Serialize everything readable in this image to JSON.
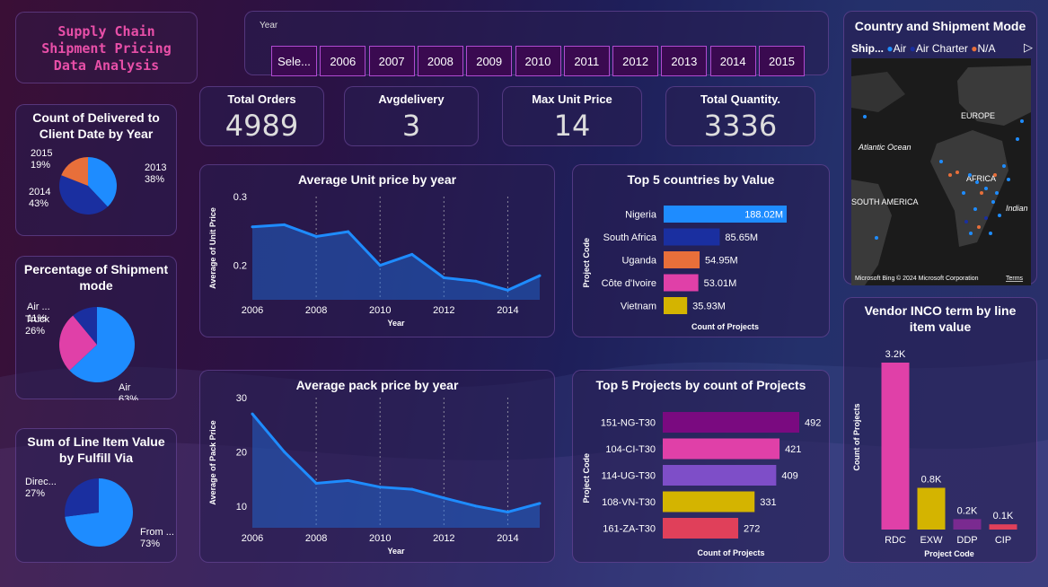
{
  "report_title": [
    "Supply Chain",
    "Shipment Pricing",
    "Data Analysis"
  ],
  "year_filter": {
    "label": "Year",
    "options": [
      "Sele...",
      "2006",
      "2007",
      "2008",
      "2009",
      "2010",
      "2011",
      "2012",
      "2013",
      "2014",
      "2015"
    ]
  },
  "kpis": [
    {
      "label": "Total Orders",
      "value": "4989"
    },
    {
      "label": "Avgdelivery",
      "value": "3"
    },
    {
      "label": "Max Unit Price",
      "value": "14"
    },
    {
      "label": "Total Quantity.",
      "value": "3336"
    }
  ],
  "map": {
    "title": "Country and Shipment Mode",
    "legend_title": "Ship...",
    "legend": [
      {
        "name": "Air",
        "color": "#1e8cff"
      },
      {
        "name": "Air Charter",
        "color": "#1a2fa0"
      },
      {
        "name": "N/A",
        "color": "#e86f3a"
      }
    ],
    "labels": [
      "Atlantic Ocean",
      "EUROPE",
      "AFRICA",
      "SOUTH AMERICA",
      "Indian"
    ],
    "credit": "© 2024 Microsoft Corporation",
    "terms": "Terms",
    "brand": "Microsoft Bing"
  },
  "chart_data": [
    {
      "id": "delivered_by_year",
      "type": "pie",
      "title": "Count of Delivered to Client Date by Year",
      "slices": [
        {
          "label": "2013",
          "pct": "38%",
          "value": 38,
          "color": "#1e8cff"
        },
        {
          "label": "2014",
          "pct": "43%",
          "value": 43,
          "color": "#1a2fa0"
        },
        {
          "label": "2015",
          "pct": "19%",
          "value": 19,
          "color": "#e86f3a"
        }
      ]
    },
    {
      "id": "shipment_mode",
      "type": "pie",
      "title": "Percentage of Shipment mode",
      "slices": [
        {
          "label": "Air",
          "pct": "63%",
          "value": 63,
          "color": "#1e8cff"
        },
        {
          "label": "Truck",
          "pct": "26%",
          "value": 26,
          "color": "#e040a8"
        },
        {
          "label": "Air ...",
          "pct": "11%",
          "value": 11,
          "color": "#1a2fa0"
        }
      ]
    },
    {
      "id": "fulfill_via",
      "type": "pie",
      "title": "Sum of Line Item Value by Fulfill Via",
      "slices": [
        {
          "label": "From ...",
          "pct": "73%",
          "value": 73,
          "color": "#1e8cff"
        },
        {
          "label": "Direc...",
          "pct": "27%",
          "value": 27,
          "color": "#1a2fa0"
        }
      ]
    },
    {
      "id": "unit_price",
      "type": "area",
      "title": "Average Unit price by year",
      "xlabel": "Year",
      "ylabel": "Average of Unit Price",
      "x": [
        2006,
        2007,
        2008,
        2009,
        2010,
        2011,
        2012,
        2013,
        2014,
        2015
      ],
      "y": [
        0.256,
        0.259,
        0.242,
        0.249,
        0.2,
        0.216,
        0.182,
        0.177,
        0.164,
        0.185
      ],
      "xticks": [
        2006,
        2008,
        2010,
        2012,
        2014
      ],
      "yticks": [
        "0.2",
        "0.3"
      ],
      "ytick_values": [
        0.2,
        0.3
      ],
      "ylim": [
        0.15,
        0.3
      ],
      "xlim": [
        2006,
        2015
      ]
    },
    {
      "id": "pack_price",
      "type": "area",
      "title": "Average pack price by year",
      "xlabel": "Year",
      "ylabel": "Average of Pack Price",
      "x": [
        2006,
        2007,
        2008,
        2009,
        2010,
        2011,
        2012,
        2013,
        2014,
        2015
      ],
      "y": [
        27.0,
        20.0,
        14.2,
        14.7,
        13.5,
        13.1,
        11.5,
        10.0,
        8.9,
        10.5
      ],
      "xticks": [
        2006,
        2008,
        2010,
        2012,
        2014
      ],
      "yticks": [
        "10",
        "20",
        "30"
      ],
      "ytick_values": [
        10,
        20,
        30
      ],
      "ylim": [
        6,
        30
      ],
      "xlim": [
        2006,
        2015
      ]
    },
    {
      "id": "top_countries",
      "type": "bar",
      "title": "Top 5 countries by Value",
      "xlabel": "Count of Projects",
      "ylabel": "Project Code",
      "categories": [
        "Nigeria",
        "South Africa",
        "Uganda",
        "Côte d'Ivoire",
        "Vietnam"
      ],
      "values": [
        188.02,
        85.65,
        54.95,
        53.01,
        35.93
      ],
      "labels": [
        "188.02M",
        "85.65M",
        "54.95M",
        "53.01M",
        "35.93M"
      ],
      "colors": [
        "#1e8cff",
        "#1a2fa0",
        "#e86f3a",
        "#e040a8",
        "#d4b400"
      ],
      "xmax": 188.02
    },
    {
      "id": "top_projects",
      "type": "bar",
      "title": "Top 5 Projects by count of Projects",
      "xlabel": "Count of Projects",
      "ylabel": "Project Code",
      "categories": [
        "151-NG-T30",
        "104-CI-T30",
        "114-UG-T30",
        "108-VN-T30",
        "161-ZA-T30"
      ],
      "values": [
        492,
        421,
        409,
        331,
        272
      ],
      "labels": [
        "492",
        "421",
        "409",
        "331",
        "272"
      ],
      "colors": [
        "#7a0a80",
        "#e040a8",
        "#7e4ec8",
        "#d4b400",
        "#e0405a"
      ],
      "xmax": 492
    },
    {
      "id": "vendor_inco",
      "type": "bar",
      "title": "Vendor INCO term by line item value",
      "xlabel": "Project Code",
      "ylabel": "Count of Projects",
      "categories": [
        "RDC",
        "EXW",
        "DDP",
        "CIP"
      ],
      "values": [
        3200,
        800,
        200,
        100
      ],
      "labels": [
        "3.2K",
        "0.8K",
        "0.2K",
        "0.1K"
      ],
      "colors": [
        "#e040a8",
        "#d4b400",
        "#7a2a90",
        "#e0405a"
      ],
      "ymax": 3200
    }
  ]
}
